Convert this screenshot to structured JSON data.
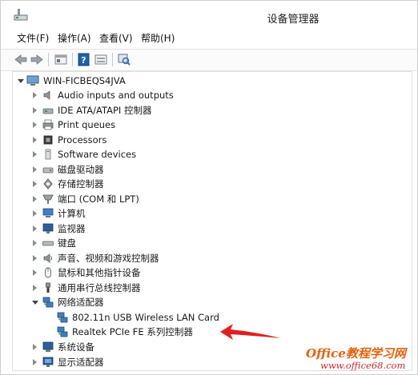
{
  "window": {
    "title": "设备管理器"
  },
  "menubar": [
    {
      "label": "文件(F)"
    },
    {
      "label": "操作(A)"
    },
    {
      "label": "查看(V)"
    },
    {
      "label": "帮助(H)"
    }
  ],
  "toolbar": [
    "back-icon",
    "forward-icon",
    "properties-icon",
    "help-icon",
    "show-hidden-icon",
    "scan-hardware-icon"
  ],
  "tree": {
    "root": {
      "label": "WIN-FICBEQS4JVA",
      "icon": "computer-icon"
    },
    "categories": [
      {
        "label": "Audio inputs and outputs",
        "icon": "speaker-icon"
      },
      {
        "label": "IDE ATA/ATAPI 控制器",
        "icon": "ide-controller-icon"
      },
      {
        "label": "Print queues",
        "icon": "printer-icon"
      },
      {
        "label": "Processors",
        "icon": "processor-icon"
      },
      {
        "label": "Software devices",
        "icon": "software-device-icon"
      },
      {
        "label": "磁盘驱动器",
        "icon": "disk-drive-icon"
      },
      {
        "label": "存储控制器",
        "icon": "storage-controller-icon"
      },
      {
        "label": "端口 (COM 和 LPT)",
        "icon": "port-icon"
      },
      {
        "label": "计算机",
        "icon": "computer-category-icon"
      },
      {
        "label": "监视器",
        "icon": "monitor-icon"
      },
      {
        "label": "键盘",
        "icon": "keyboard-icon"
      },
      {
        "label": "声音、视频和游戏控制器",
        "icon": "sound-video-icon"
      },
      {
        "label": "鼠标和其他指针设备",
        "icon": "mouse-icon"
      },
      {
        "label": "通用串行总线控制器",
        "icon": "usb-icon"
      },
      {
        "label": "网络适配器",
        "icon": "network-adapter-icon",
        "expanded": true,
        "children": [
          {
            "label": "802.11n USB Wireless LAN Card",
            "icon": "network-card-icon"
          },
          {
            "label": "Realtek PCIe FE 系列控制器",
            "icon": "network-card-icon"
          }
        ]
      },
      {
        "label": "系统设备",
        "icon": "system-device-icon"
      },
      {
        "label": "显示适配器",
        "icon": "display-adapter-icon"
      }
    ]
  },
  "watermark": {
    "title": "Office教程学习网",
    "url": "www.office68.com"
  },
  "colors": {
    "arrow": "#e02020",
    "watermark_title": "#e8610d",
    "watermark_url": "#cc2a2a"
  }
}
